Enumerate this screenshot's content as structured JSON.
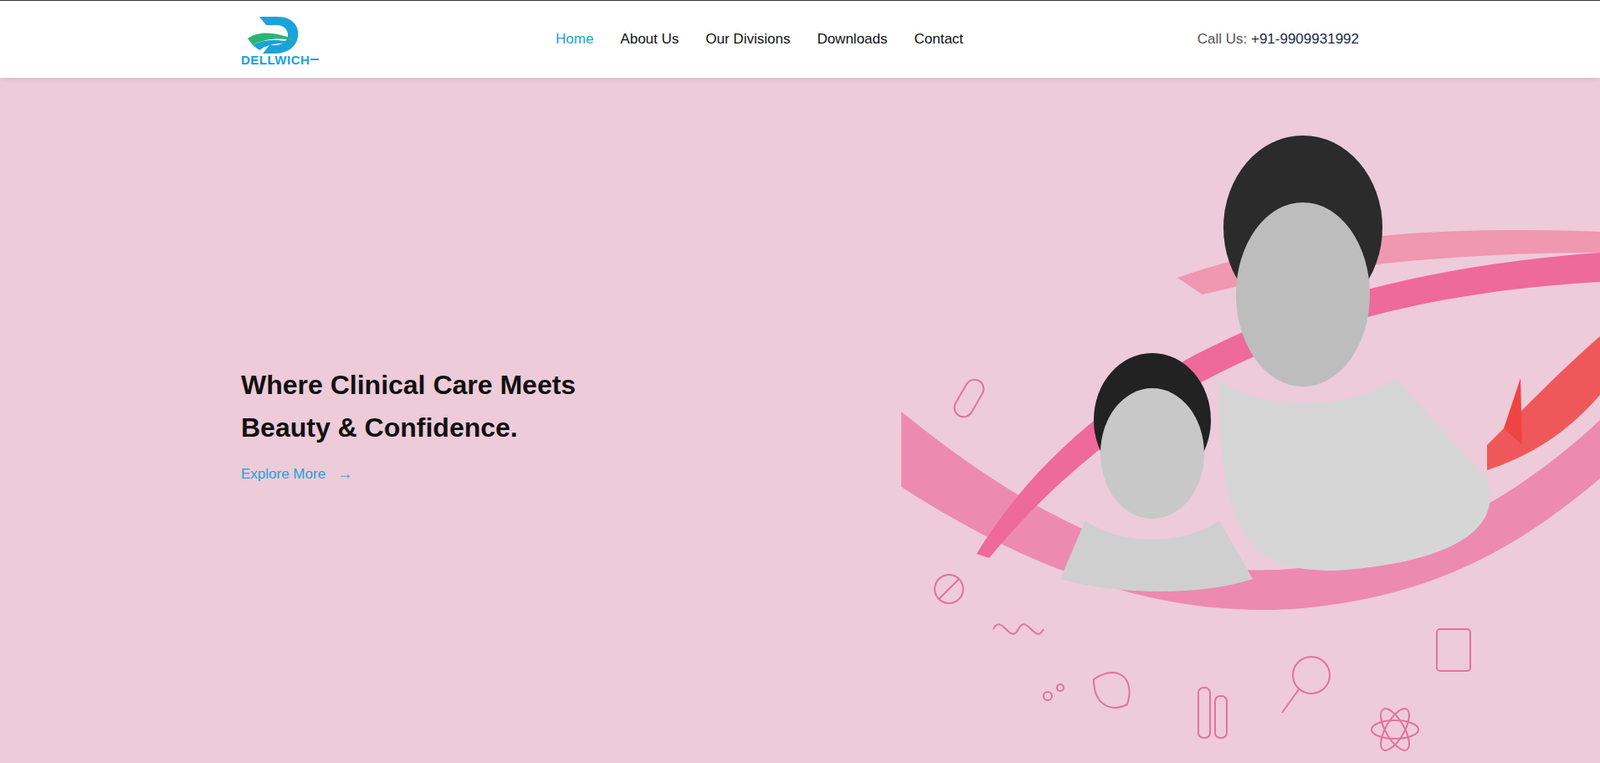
{
  "logo": {
    "text": "DELLWICH"
  },
  "nav": [
    {
      "label": "Home",
      "selected": true
    },
    {
      "label": "About Us",
      "selected": false
    },
    {
      "label": "Our Divisions",
      "selected": false
    },
    {
      "label": "Downloads",
      "selected": false
    },
    {
      "label": "Contact",
      "selected": false
    }
  ],
  "call": {
    "label": "Call Us:",
    "number": "+91-9909931992"
  },
  "hero": {
    "heading_lines": [
      "Where Clinical Care Meets",
      "Beauty & Confidence."
    ],
    "cta": "Explore More",
    "cta_icon": "→"
  }
}
